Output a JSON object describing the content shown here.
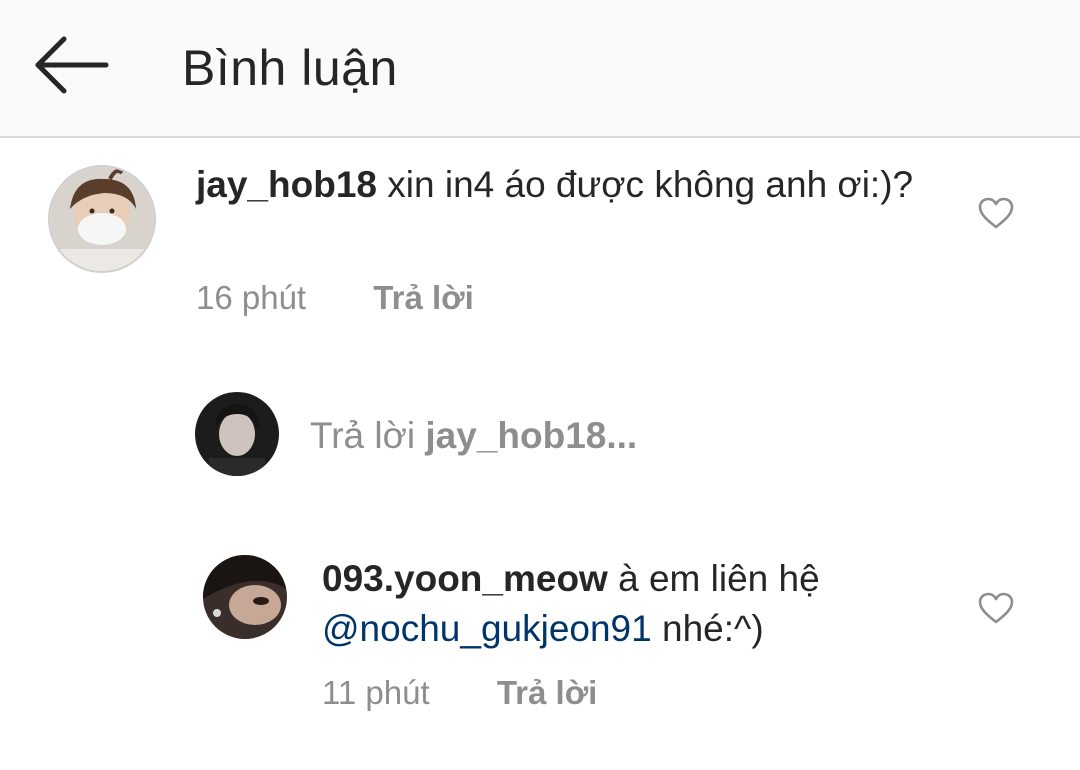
{
  "header": {
    "title": "Bình luận"
  },
  "comment": {
    "username": "jay_hob18",
    "text": "xin in4 áo được không anh ơi:)?",
    "time": "16 phút",
    "reply_label": "Trả lời"
  },
  "reply_composer": {
    "prefix": "Trả lời",
    "target": "jay_hob18..."
  },
  "reply": {
    "username": "093.yoon_meow",
    "text_before": "à em liên hệ",
    "mention": "@nochu_gukjeon91",
    "text_after": "nhé:^)",
    "time": "11 phút",
    "reply_label": "Trả lời"
  },
  "icons": {
    "back": "arrow-left-icon",
    "like": "heart-outline-icon"
  },
  "colors": {
    "text": "#262626",
    "secondary": "#8e8e8e",
    "mention": "#003569",
    "header_bg": "#fafafa"
  }
}
